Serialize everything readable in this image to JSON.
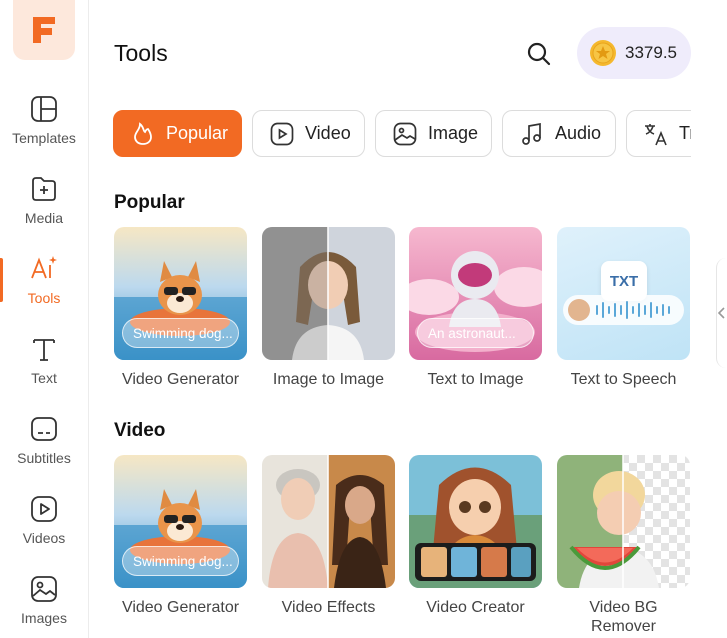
{
  "header": {
    "title": "Tools",
    "credits": "3379.5"
  },
  "sidebar": {
    "items": [
      {
        "label": "Templates"
      },
      {
        "label": "Media"
      },
      {
        "label": "Tools"
      },
      {
        "label": "Text"
      },
      {
        "label": "Subtitles"
      },
      {
        "label": "Videos"
      },
      {
        "label": "Images"
      }
    ],
    "active": "Tools"
  },
  "filters": [
    {
      "label": "Popular",
      "icon": "flame-icon"
    },
    {
      "label": "Video",
      "icon": "play-icon"
    },
    {
      "label": "Image",
      "icon": "image-icon"
    },
    {
      "label": "Audio",
      "icon": "music-icon"
    },
    {
      "label": "Tr",
      "icon": "translate-icon"
    }
  ],
  "sections": {
    "popular": {
      "title": "Popular",
      "cards": [
        {
          "label": "Video Generator",
          "overlay": "Swimming dog..."
        },
        {
          "label": "Image to Image"
        },
        {
          "label": "Text to Image",
          "overlay": "An astronaut..."
        },
        {
          "label": "Text to Speech",
          "badge": "TXT"
        }
      ]
    },
    "video": {
      "title": "Video",
      "cards": [
        {
          "label": "Video Generator",
          "overlay": "Swimming dog..."
        },
        {
          "label": "Video Effects"
        },
        {
          "label": "Video Creator"
        },
        {
          "label": "Video BG Remover"
        }
      ]
    }
  },
  "colors": {
    "accent": "#f26a23",
    "credits_bg": "#efecfb",
    "coin": "#f5b82e"
  }
}
